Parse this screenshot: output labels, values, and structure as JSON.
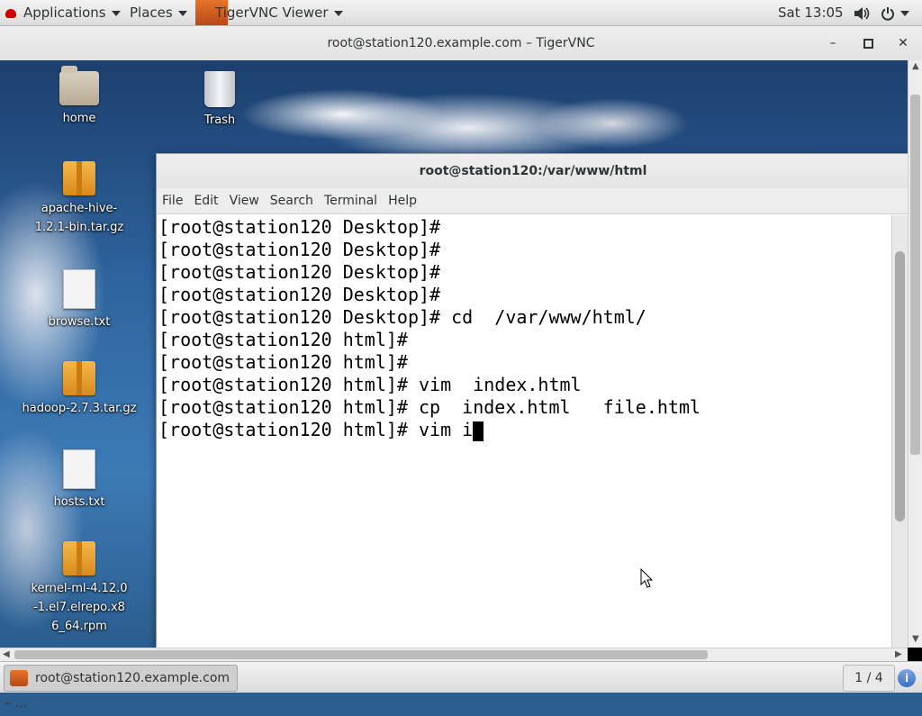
{
  "top_panel": {
    "applications": "Applications",
    "places": "Places",
    "vnc_app": "TigerVNC Viewer",
    "clock": "Sat 13:05"
  },
  "vnc_window": {
    "title": "root@station120.example.com – TigerVNC",
    "minimize": "–",
    "maximize": "▫",
    "close": "✕"
  },
  "desktop_icons": [
    {
      "label": "home",
      "icon": "folder-home-icon"
    },
    {
      "label": "Trash",
      "icon": "trash-icon"
    },
    {
      "label": "apache-hive-1.2.1-bin.tar.gz",
      "icon": "archive-icon"
    },
    {
      "label": "browse.txt",
      "icon": "text-file-icon"
    },
    {
      "label": "hadoop-2.7.3.tar.gz",
      "icon": "archive-icon"
    },
    {
      "label": "hosts.txt",
      "icon": "text-file-icon"
    },
    {
      "label": "kernel-ml-4.12.0-1.el7.elrepo.x86_64.rpm",
      "icon": "package-icon"
    }
  ],
  "terminal": {
    "title": "root@station120:/var/www/html",
    "menu": [
      "File",
      "Edit",
      "View",
      "Search",
      "Terminal",
      "Help"
    ],
    "lines": [
      "[root@station120 Desktop]#",
      "[root@station120 Desktop]#",
      "[root@station120 Desktop]#",
      "[root@station120 Desktop]#",
      "[root@station120 Desktop]# cd  /var/www/html/",
      "[root@station120 html]#",
      "[root@station120 html]#",
      "[root@station120 html]# vim  index.html",
      "[root@station120 html]# cp  index.html   file.html",
      "[root@station120 html]# vim i"
    ]
  },
  "taskbar": {
    "item": "root@station120.example.com – ...",
    "workspace": "1 / 4"
  }
}
